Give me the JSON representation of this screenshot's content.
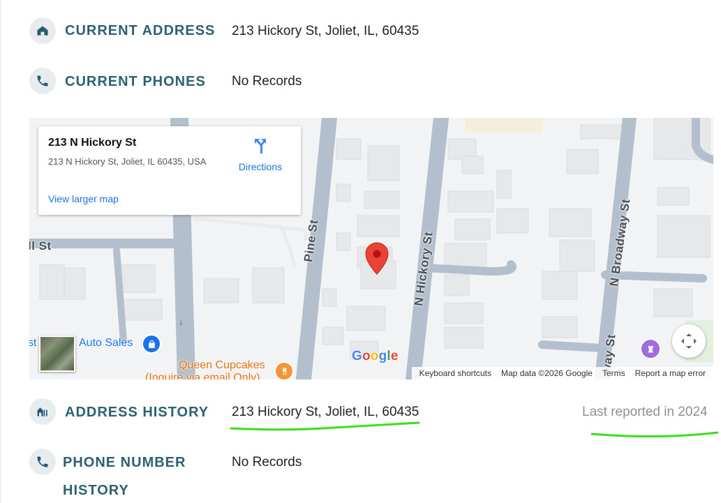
{
  "current_address": {
    "label": "CURRENT ADDRESS",
    "value": "213 Hickory St, Joliet, IL, 60435"
  },
  "current_phones": {
    "label": "CURRENT PHONES",
    "value": "No Records"
  },
  "map": {
    "card_title": "213 N Hickory St",
    "card_address": "213 N Hickory St, Joliet, IL 60435, USA",
    "view_larger": "View larger map",
    "directions": "Directions",
    "streets": {
      "pine": "Pine St",
      "hickory": "N Hickory St",
      "broadway": "N Broadway St",
      "broadway_lower": "way St",
      "ll": "ll St"
    },
    "pois": {
      "auto_sales": "Auto Sales",
      "auto_prefix": "st",
      "queen_cupcakes": "Queen Cupcakes",
      "queen_sub": "(Inquire via email Only)"
    },
    "google": "Google",
    "attribution": {
      "shortcuts": "Keyboard shortcuts",
      "data": "Map data ©2026 Google",
      "terms": "Terms",
      "report": "Report a map error"
    }
  },
  "address_history": {
    "label": "ADDRESS HISTORY",
    "value": "213 Hickory St, Joliet, IL, 60435",
    "last_reported": "Last reported in 2024"
  },
  "phone_history": {
    "label_line1": "PHONE NUMBER",
    "label_line2": "HISTORY",
    "value": "No Records"
  },
  "colors": {
    "accent": "#2d6070",
    "link": "#1a73e8",
    "pin": "#ea4335",
    "annotation": "#39e01a"
  }
}
